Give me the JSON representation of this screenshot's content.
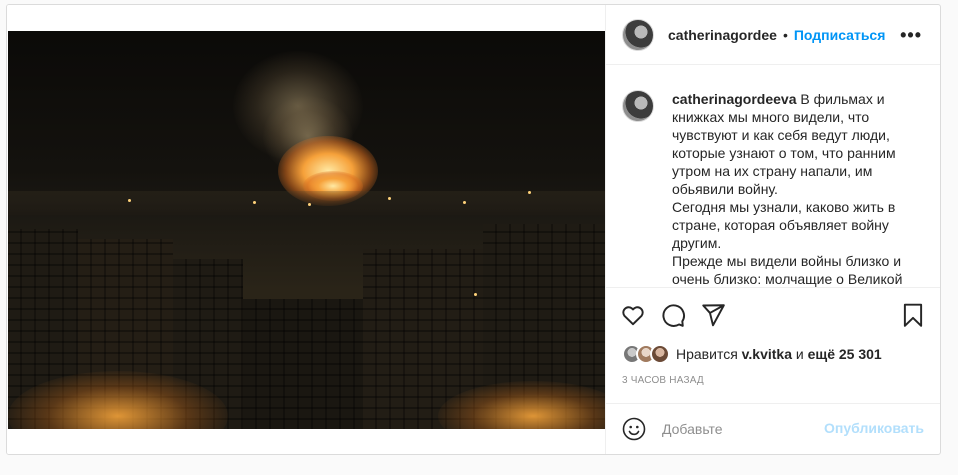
{
  "post": {
    "username": "catherinagordee",
    "follow_label": "Подписаться",
    "separator": "•",
    "more_label": "•••",
    "caption": {
      "username": "catherinagordeeva",
      "paragraphs": [
        "В фильмах и книжках мы много видели, что чувствуют и как себя ведут люди, которые узнают о том, что ранним утром на их страну напали, им обьявили войну.",
        "Сегодня мы узнали, каково жить в стране, которая объявляет войну другим.",
        "Прежде мы видели войны близко и очень близко: молчащие о Великой"
      ]
    },
    "likes": {
      "prefix": "Нравится",
      "liker": "v.kvitka",
      "conjunction": "и",
      "others": "ещё 25 301"
    },
    "timestamp": "3 ЧАСОВ НАЗАД",
    "comment": {
      "placeholder": "Добавьте",
      "publish_label": "Опубликовать"
    },
    "icons": [
      "heart-icon",
      "comment-icon",
      "share-icon",
      "bookmark-icon",
      "more-icon",
      "emoji-icon"
    ],
    "colors": {
      "accent": "#0095f6",
      "publish_disabled": "#b2dffc",
      "secondary_text": "#8e8e8e",
      "border": "#dbdbdb"
    }
  }
}
